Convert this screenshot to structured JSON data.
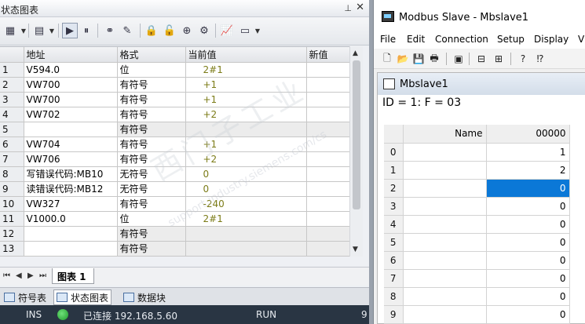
{
  "left_panel": {
    "title": "状态图表",
    "pin_glyph": "⊥",
    "close_glyph": "✕",
    "columns": [
      "",
      "地址",
      "格式",
      "当前值",
      "新值"
    ],
    "rows": [
      {
        "n": "1",
        "addr": "V594.0",
        "fmt": "位",
        "val": "2#1",
        "shaded": false
      },
      {
        "n": "2",
        "addr": "VW700",
        "fmt": "有符号",
        "val": "+1",
        "shaded": false
      },
      {
        "n": "3",
        "addr": "VW700",
        "fmt": "有符号",
        "val": "+1",
        "shaded": false
      },
      {
        "n": "4",
        "addr": "VW702",
        "fmt": "有符号",
        "val": "+2",
        "shaded": false
      },
      {
        "n": "5",
        "addr": "",
        "fmt": "有符号",
        "val": "",
        "shaded": true
      },
      {
        "n": "6",
        "addr": "VW704",
        "fmt": "有符号",
        "val": "+1",
        "shaded": false
      },
      {
        "n": "7",
        "addr": "VW706",
        "fmt": "有符号",
        "val": "+2",
        "shaded": false
      },
      {
        "n": "8",
        "addr": "写错误代码:MB10",
        "fmt": "无符号",
        "val": "0",
        "shaded": false
      },
      {
        "n": "9",
        "addr": "读错误代码:MB12",
        "fmt": "无符号",
        "val": "0",
        "shaded": false
      },
      {
        "n": "10",
        "addr": "VW327",
        "fmt": "有符号",
        "val": "-240",
        "shaded": false
      },
      {
        "n": "11",
        "addr": "V1000.0",
        "fmt": "位",
        "val": "2#1",
        "shaded": false
      },
      {
        "n": "12",
        "addr": "",
        "fmt": "有符号",
        "val": "",
        "shaded": true
      },
      {
        "n": "13",
        "addr": "",
        "fmt": "有符号",
        "val": "",
        "shaded": true
      }
    ],
    "sheet_tab": "图表 1",
    "bottom_tabs": [
      "符号表",
      "状态图表",
      "数据块"
    ],
    "active_bottom_tab": "状态图表",
    "status": {
      "mode": "INS",
      "connection": "已连接 192.168.5.60",
      "run_state": "RUN",
      "extra": "9"
    },
    "toolbar_icons": [
      "table-icon",
      "dropdown-icon",
      "insert-icon",
      "dropdown-icon",
      "monitor-icon",
      "pause-icon",
      "glasses-icon",
      "pencil-icon",
      "lock-icon",
      "unlock-icon",
      "lock-add-icon",
      "force-icon",
      "trend-icon",
      "display-icon",
      "dropdown-icon"
    ]
  },
  "modbus": {
    "window_title": "Modbus Slave - Mbslave1",
    "menu": [
      "File",
      "Edit",
      "Connection",
      "Setup",
      "Display",
      "Vi"
    ],
    "child_title": "Mbslave1",
    "id_line": "ID = 1: F = 03",
    "name_header": "Name",
    "address_header": "00000",
    "rows": [
      {
        "n": "0",
        "value": "1"
      },
      {
        "n": "1",
        "value": "2"
      },
      {
        "n": "2",
        "value": "0"
      },
      {
        "n": "3",
        "value": "0"
      },
      {
        "n": "4",
        "value": "0"
      },
      {
        "n": "5",
        "value": "0"
      },
      {
        "n": "6",
        "value": "0"
      },
      {
        "n": "7",
        "value": "0"
      },
      {
        "n": "8",
        "value": "0"
      },
      {
        "n": "9",
        "value": "0"
      }
    ],
    "selected_row": "2",
    "selection_color": "#0b78d7"
  },
  "watermark": {
    "main": "西门子工业",
    "sub": "support.industry.siemens.com/cs"
  }
}
